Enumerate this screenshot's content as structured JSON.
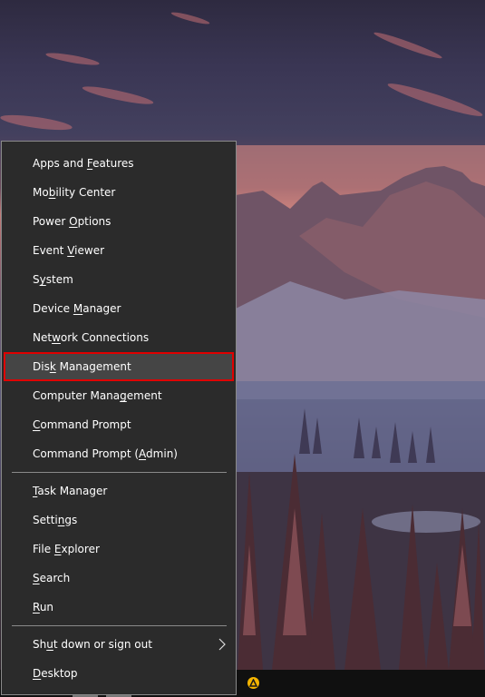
{
  "wallpaper": {
    "description": "mountain-forest-sunset"
  },
  "menu": {
    "groups": [
      [
        {
          "pre": "Apps and ",
          "key": "F",
          "post": "eatures"
        },
        {
          "pre": "Mo",
          "key": "b",
          "post": "ility Center"
        },
        {
          "pre": "Power ",
          "key": "O",
          "post": "ptions"
        },
        {
          "pre": "Event ",
          "key": "V",
          "post": "iewer"
        },
        {
          "pre": "S",
          "key": "y",
          "post": "stem"
        },
        {
          "pre": "Device ",
          "key": "M",
          "post": "anager"
        },
        {
          "pre": "Net",
          "key": "w",
          "post": "ork Connections"
        },
        {
          "pre": "Dis",
          "key": "k",
          "post": " Management",
          "highlighted": true
        },
        {
          "pre": "Computer Mana",
          "key": "g",
          "post": "ement"
        },
        {
          "pre": "",
          "key": "C",
          "post": "ommand Prompt"
        },
        {
          "pre": "Command Prompt (",
          "key": "A",
          "post": "dmin)"
        }
      ],
      [
        {
          "pre": "",
          "key": "T",
          "post": "ask Manager"
        },
        {
          "pre": "Setti",
          "key": "n",
          "post": "gs"
        },
        {
          "pre": "File ",
          "key": "E",
          "post": "xplorer"
        },
        {
          "pre": "",
          "key": "S",
          "post": "earch"
        },
        {
          "pre": "",
          "key": "R",
          "post": "un"
        }
      ],
      [
        {
          "pre": "Sh",
          "key": "u",
          "post": "t down or sign out",
          "submenu": true
        },
        {
          "pre": "",
          "key": "D",
          "post": "esktop"
        }
      ]
    ],
    "highlight_color": "#e00000"
  },
  "taskbar": {
    "tray_icon": "avast-style-app-icon",
    "tray_icon_color": "#f4b400"
  }
}
